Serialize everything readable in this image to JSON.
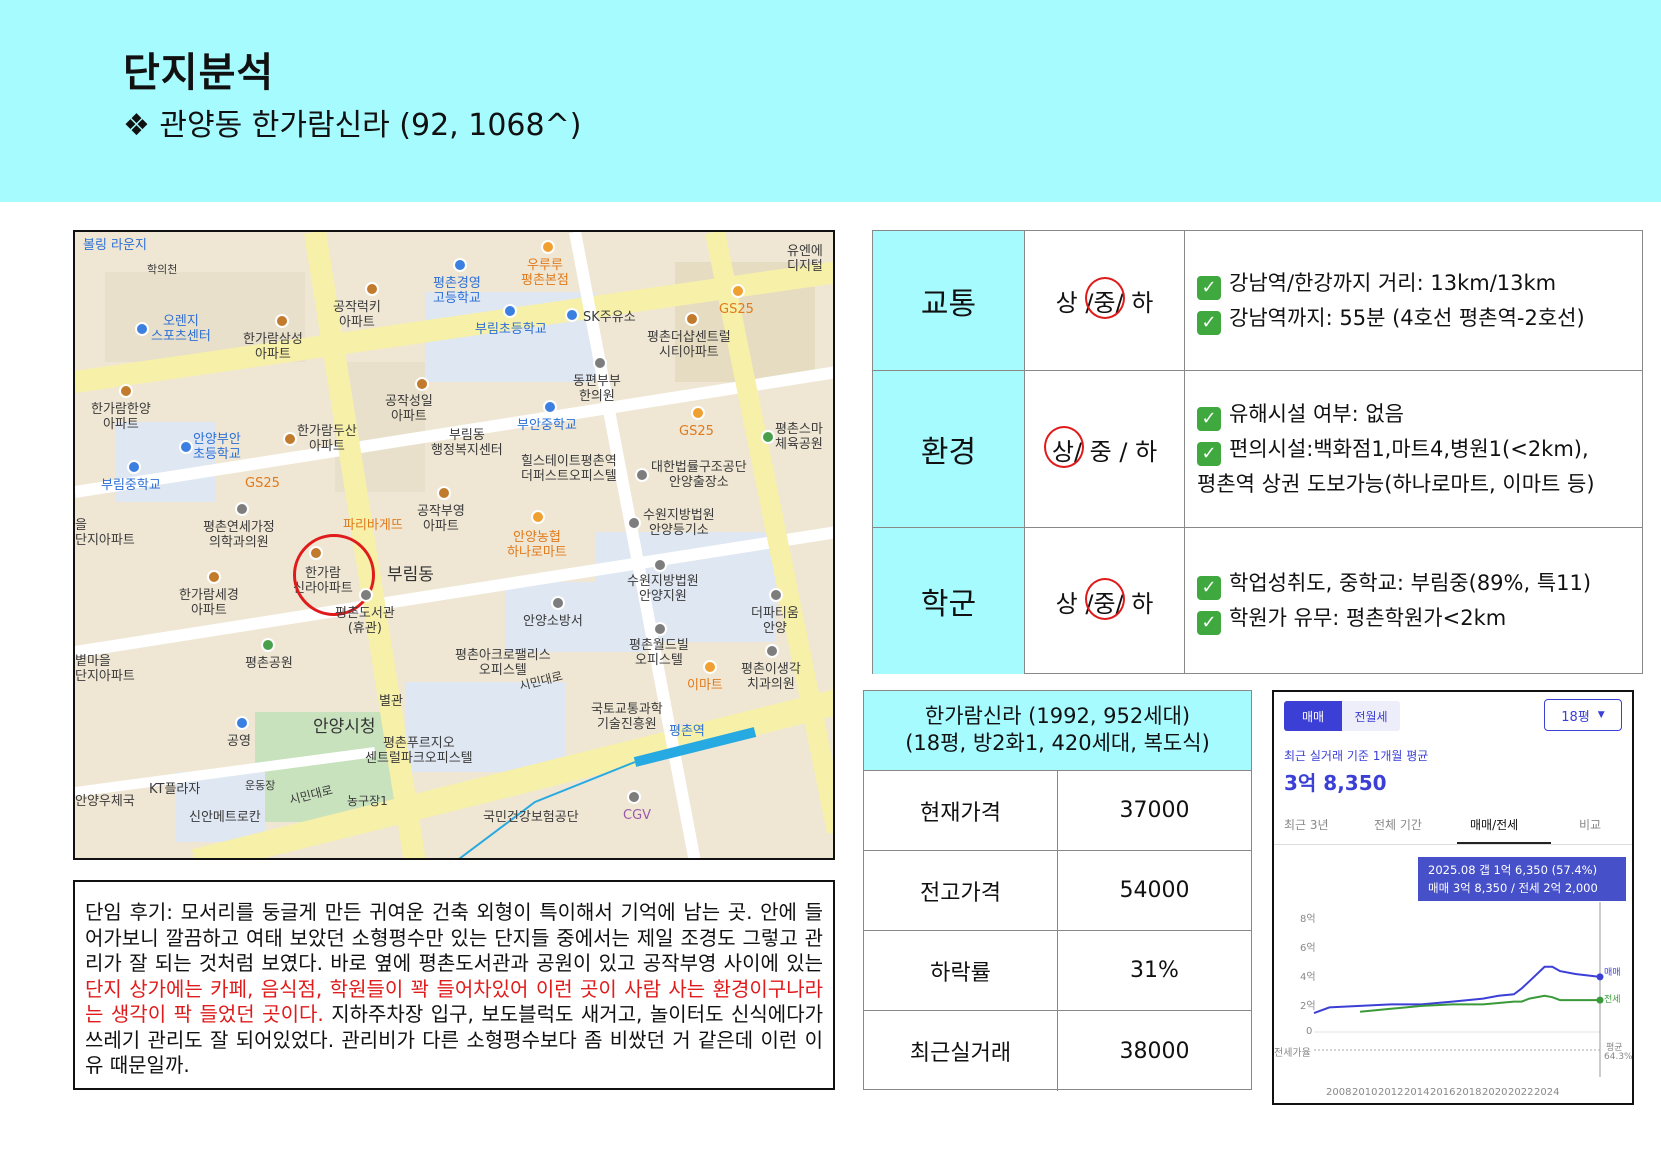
{
  "header": {
    "title": "단지분석",
    "subtitle": "❖ 관양동 한가람신라 (92, 1068^)"
  },
  "map": {
    "labels": {
      "bowling": "볼링 라운지",
      "hakui": "학의천",
      "orange_sports": "오렌지\n스포츠센터",
      "hangaram_samsung": "한가람삼성\n아파트",
      "gongjak_lucky": "공작럭키\n아파트",
      "pyeongchon_hs": "평촌경영\n고등학교",
      "woorururu": "우루루\n평촌본점",
      "sk_gas": "SK주유소",
      "gs25_a": "GS25",
      "bulim_es": "부림초등학교",
      "pyeongchon_thesharp": "평촌더샵센트럴\n시티아파트",
      "youne": "유엔에\n디지털",
      "hangaram_hanyang": "한가람한양\n아파트",
      "gongjak_sungil": "공작성일\n아파트",
      "dongpyeon": "동편부부\n한의원",
      "buan_ms": "부안중학교",
      "gs25_b": "GS25",
      "pyeongchon_smart": "평촌스마\n체육공원",
      "anyang_buan_es": "안양부안\n초등학교",
      "hangaram_dusan": "한가람두산\n아파트",
      "bulimdong_center": "부림동\n행정복지센터",
      "hillstate": "힐스테이트평촌역\n더퍼스트오피스텔",
      "legal_aid": "대한법률구조공단\n안양출장소",
      "bulim_ms": "부림중학교",
      "gs25_c": "GS25",
      "yonsei_clinic": "평촌연세가정\n의학과의원",
      "paris": "파리바게뜨",
      "gongjak_buyoung": "공작부영\n아파트",
      "nonghyup": "안양농협\n하나로마트",
      "suwon_court_reg": "수원지방법원\n안양등기소",
      "target": "한가람\n신라아파트",
      "bulimdong": "부림동",
      "hangaram_sekyung": "한가람세경\n아파트",
      "suwon_court": "수원지방법원\n안양지원",
      "library": "평촌도서관\n(휴관)",
      "fire_station": "안양소방서",
      "departing": "더파티움\n안양",
      "park": "평촌공원",
      "acro": "평촌아크로팰리스\n오피스텔",
      "world_bill": "평촌월드빌\n오피스텔",
      "emart": "이마트",
      "dental": "평촌이생각\n치과의원",
      "annex": "별관",
      "city_hall": "안양시청",
      "gongyeong": "공영",
      "transport_inst": "국토교통과학\n기술진흥원",
      "pyeongchon_station": "평촌역",
      "central_park": "평촌푸르지오\n센트럴파크오피스텔",
      "kt_plaza": "KT플라자",
      "field": "운동장",
      "post": "안양우체국",
      "shinan": "신안메트로칸",
      "nonggujang": "농구장1",
      "nhis": "국민건강보험공단",
      "cgv": "CGV",
      "road_simin": "시민대로",
      "road_simin2": "시민대로",
      "apt_left1": "을\n단지아파트",
      "apt_left2": "볕마을\n단지아파트"
    }
  },
  "review": {
    "text_before": "단임 후기: 모서리를 둥글게 만든 귀여운 건축 외형이 특이해서 기억에 남는 곳. 안에 들어가보니 깔끔하고 여태 보았던 소형평수만 있는 단지들 중에서는 제일 조경도 그렇고 관리가 잘 되는 것처럼 보였다. 바로 옆에 평촌도서관과 공원이 있고 공작부영 사이에 있는 ",
    "text_highlight": "단지 상가에는 카페, 음식점, 학원들이 꽉 들어차있어 이런 곳이 사람 사는 환경이구나라는 생각이 팍 들었던 곳이다.",
    "text_after": " 지하주차장 입구, 보도블럭도 새거고, 놀이터도 신식에다가 쓰레기 관리도 잘 되어있었다. 관리비가 다른 소형평수보다 좀 비쌌던 거 같은데 이런 이유 때문일까."
  },
  "analysis": [
    {
      "category": "교통",
      "grade_before": "상 /",
      "grade_mark": "중",
      "grade_after": "/ 하",
      "details": [
        "강남역/한강까지 거리: 13km/13km",
        "강남역까지: 55분 (4호선 평촌역-2호선)"
      ]
    },
    {
      "category": "환경",
      "grade_before": "",
      "grade_mark": "상",
      "grade_after": "/ 중 / 하",
      "details": [
        "유해시설 여부: 없음",
        "편의시설:백화점1,마트4,병원1(<2km),",
        "평촌역 상권 도보가능(하나로마트, 이마트 등)"
      ]
    },
    {
      "category": "학군",
      "grade_before": "상 /",
      "grade_mark": "중",
      "grade_after": "/ 하",
      "details": [
        "학업성취도, 중학교: 부림중(89%, 특11)",
        "학원가 유무: 평촌학원가<2km"
      ]
    }
  ],
  "price_table": {
    "header_line1": "한가람신라 (1992, 952세대)",
    "header_line2": "(18평, 방2화1, 420세대, 복도식)",
    "rows": [
      {
        "label": "현재가격",
        "value": "37000"
      },
      {
        "label": "전고가격",
        "value": "54000"
      },
      {
        "label": "하락률",
        "value": "31%"
      },
      {
        "label": "최근실거래",
        "value": "38000"
      }
    ]
  },
  "chart_widget": {
    "toggle_sale": "매매",
    "toggle_rent": "전월세",
    "period": "18평",
    "caption": "최근 실거래 기준 1개월 평균",
    "avg_price": "3억 8,350",
    "tabs": [
      "최근 3년",
      "전체 기간",
      "매매/전세",
      "비교"
    ],
    "tooltip_line1": "2025.08  갭 1억 6,350 (57.4%)",
    "tooltip_line2": "매매 3억 8,350 / 전세 2억 2,000",
    "y_labels": [
      "8억",
      "6억",
      "4억",
      "2억",
      "0"
    ],
    "x_labels": [
      "2008",
      "2010",
      "2012",
      "2014",
      "2016",
      "2018",
      "2020",
      "2022",
      "2024"
    ],
    "series_sale": "매매",
    "series_jeonse": "전세",
    "ratio_label": "전세가율",
    "ratio_end_label": "평균",
    "ratio_end_value": "64.3%"
  },
  "chart_data": {
    "type": "line",
    "x": [
      2007,
      2008,
      2010,
      2012,
      2014,
      2016,
      2018,
      2019,
      2020,
      2020.5,
      2021,
      2022,
      2022.5,
      2023,
      2024,
      2025.6
    ],
    "series": [
      {
        "name": "매매",
        "values": [
          1.3,
          1.7,
          1.8,
          1.9,
          1.9,
          2.1,
          2.3,
          2.5,
          2.6,
          3.0,
          3.5,
          4.5,
          4.5,
          4.2,
          4.0,
          3.8
        ]
      },
      {
        "name": "전세",
        "values": [
          null,
          null,
          1.4,
          1.6,
          1.8,
          1.9,
          1.9,
          2.0,
          2.1,
          2.1,
          2.3,
          2.5,
          2.4,
          2.2,
          2.2,
          2.2
        ]
      }
    ],
    "ylim": [
      0,
      8
    ],
    "ytick_labels": [
      "0",
      "2억",
      "4억",
      "6억",
      "8억"
    ],
    "grid": false,
    "legend": "right"
  },
  "colors": {
    "header_bg": "#a6fbff",
    "accent_blue": "#3b3fd6",
    "jeonse_green": "#3a9a3a",
    "highlight_red": "#e01b1b"
  }
}
